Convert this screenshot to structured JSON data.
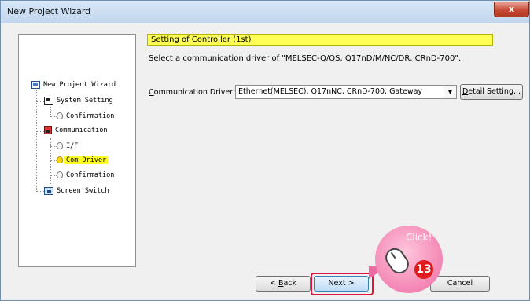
{
  "window": {
    "title": "New Project Wizard",
    "close_label": "x"
  },
  "tree": {
    "items": [
      {
        "label": "New Project Wizard",
        "icon": "wizard-icon",
        "selected": false
      },
      {
        "label": "System Setting",
        "icon": "system-icon",
        "selected": false
      },
      {
        "label": "Confirmation",
        "icon": "bulb-icon",
        "selected": false
      },
      {
        "label": "Communication",
        "icon": "communication-icon",
        "selected": false
      },
      {
        "label": "I/F",
        "icon": "bulb-icon",
        "selected": false
      },
      {
        "label": "Com Driver",
        "icon": "bulb-icon",
        "selected": true
      },
      {
        "label": "Confirmation",
        "icon": "bulb-icon",
        "selected": false
      },
      {
        "label": "Screen Switch",
        "icon": "screen-icon",
        "selected": false
      }
    ]
  },
  "main": {
    "section_title": "Setting of Controller (1st)",
    "instruction": "Select a communication driver of \"MELSEC-Q/QS, Q17nD/M/NC/DR, CRnD-700\".",
    "driver_label_first": "C",
    "driver_label_rest": "ommunication Driver:",
    "driver_value": "Ethernet(MELSEC), Q17nNC, CRnD-700, Gateway",
    "detail_first": "D",
    "detail_rest": "etail Setting..."
  },
  "buttons": {
    "back_prefix": "< ",
    "back_first": "B",
    "back_rest": "ack",
    "next": "Next >",
    "cancel": "Cancel"
  },
  "annotation": {
    "click_text": "Click!",
    "step_number": "13"
  },
  "colors": {
    "highlight_yellow": "#ffff55",
    "selected_yellow": "#ffff22",
    "callout_pink": "#ee6aa2",
    "step_red": "#e01a1a",
    "focus_red": "#e0143c"
  }
}
